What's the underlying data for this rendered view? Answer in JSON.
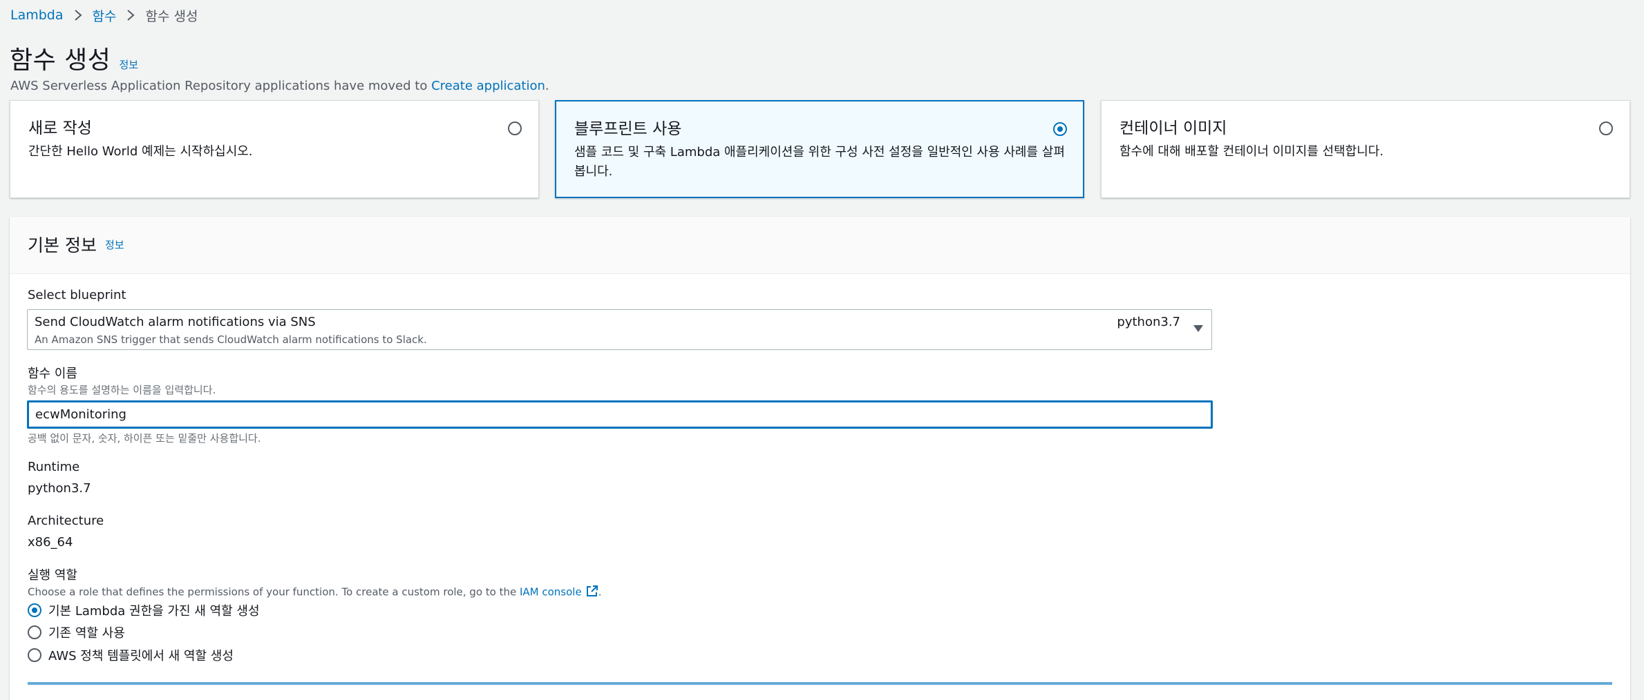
{
  "breadcrumb": {
    "items": [
      "Lambda",
      "함수"
    ],
    "current": "함수 생성"
  },
  "page": {
    "title": "함수 생성",
    "info_label": "정보",
    "notice_text": "AWS Serverless Application Repository applications have moved to ",
    "notice_link": "Create application",
    "notice_end": "."
  },
  "options": [
    {
      "title": "새로 작성",
      "desc": "간단한 Hello World 예제는 시작하십시오.",
      "selected": false
    },
    {
      "title": "블루프린트 사용",
      "desc": "샘플 코드 및 구축 Lambda 애플리케이션을 위한 구성 사전 설정을 일반적인 사용 사례를 살펴봅니다.",
      "selected": true
    },
    {
      "title": "컨테이너 이미지",
      "desc": "함수에 대해 배포할 컨테이너 이미지를 선택합니다.",
      "selected": false
    }
  ],
  "basic_info": {
    "header": "기본 정보",
    "info_label": "정보",
    "blueprint_label": "Select blueprint",
    "blueprint_title": "Send CloudWatch alarm notifications via SNS",
    "blueprint_desc": "An Amazon SNS trigger that sends CloudWatch alarm notifications to Slack.",
    "blueprint_runtime": "python3.7",
    "function_name_label": "함수 이름",
    "function_name_desc": "함수의 용도를 설명하는 이름을 입력합니다.",
    "function_name_value": "ecwMonitoring",
    "function_name_hint": "공백 없이 문자, 숫자, 하이픈 또는 밑줄만 사용합니다.",
    "runtime_label": "Runtime",
    "runtime_value": "python3.7",
    "arch_label": "Architecture",
    "arch_value": "x86_64",
    "role_label": "실행 역할",
    "role_desc": "Choose a role that defines the permissions of your function. To create a custom role, go to the ",
    "role_link": "IAM console",
    "role_desc_end": ".",
    "role_options": [
      {
        "label": "기본 Lambda 권한을 가진 새 역할 생성",
        "checked": true
      },
      {
        "label": "기존 역할 사용",
        "checked": false
      },
      {
        "label": "AWS 정책 템플릿에서 새 역할 생성",
        "checked": false
      }
    ]
  },
  "colors": {
    "link": "#0073bb",
    "selected_bg": "#f1faff",
    "page_bg": "#f2f3f3"
  }
}
